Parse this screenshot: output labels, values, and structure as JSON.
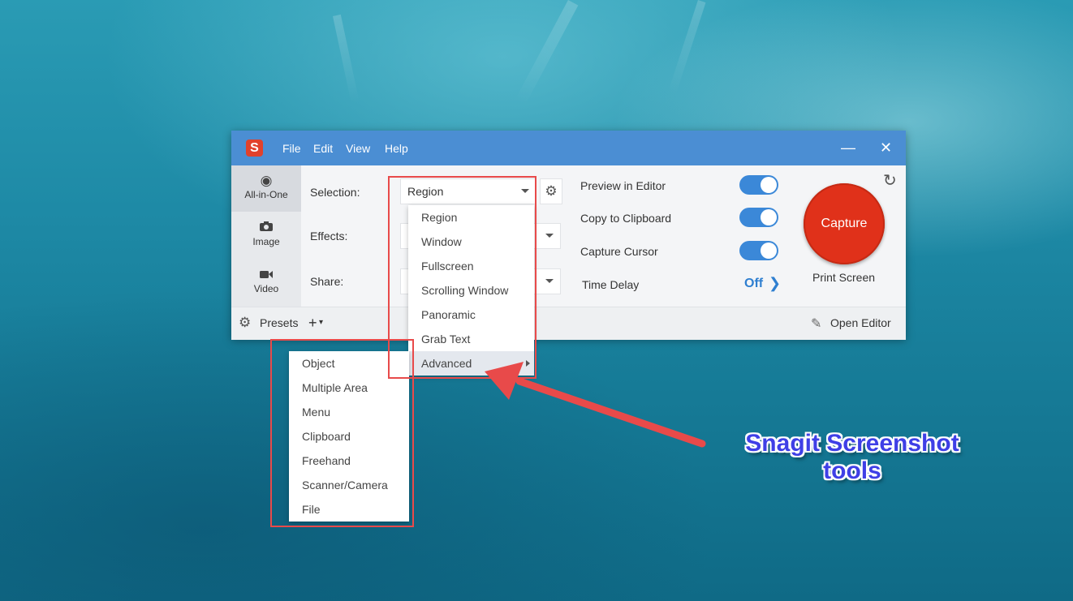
{
  "app": {
    "logo_letter": "S",
    "menu": [
      "File",
      "Edit",
      "View",
      "Help"
    ],
    "minimize": "—",
    "close": "✕"
  },
  "sidebar": {
    "modes": [
      {
        "label": "All-in-One",
        "icon": "radio-dot-icon",
        "active": true
      },
      {
        "label": "Image",
        "icon": "camera-icon",
        "active": false
      },
      {
        "label": "Video",
        "icon": "video-camera-icon",
        "active": false
      }
    ]
  },
  "settings": {
    "selection_label": "Selection:",
    "selection_value": "Region",
    "effects_label": "Effects:",
    "share_label": "Share:"
  },
  "options": {
    "preview_label": "Preview in Editor",
    "clipboard_label": "Copy to Clipboard",
    "cursor_label": "Capture Cursor",
    "delay_label": "Time Delay",
    "delay_value": "Off"
  },
  "capture": {
    "button_label": "Capture",
    "hotkey": "Print Screen"
  },
  "footer": {
    "presets_label": "Presets",
    "add_label": "+",
    "open_editor_label": "Open Editor"
  },
  "dropdown": {
    "items": [
      "Region",
      "Window",
      "Fullscreen",
      "Scrolling Window",
      "Panoramic",
      "Grab Text",
      "Advanced"
    ],
    "highlighted": "Advanced"
  },
  "submenu": {
    "items": [
      "Object",
      "Multiple Area",
      "Menu",
      "Clipboard",
      "Freehand",
      "Scanner/Camera",
      "File"
    ]
  },
  "annotation": {
    "line1": "Snagit Screenshot",
    "line2": "tools",
    "color": "#3f3fe6",
    "highlight_color": "#e84a4a"
  },
  "colors": {
    "titlebar": "#4b8ed3",
    "toggle_on": "#3b88d8",
    "capture_button": "#e0311a"
  }
}
